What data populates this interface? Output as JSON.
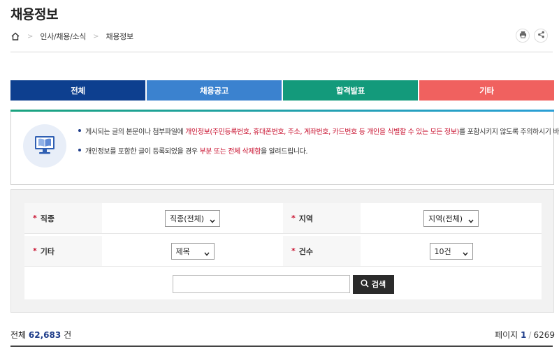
{
  "page_title": "채용정보",
  "breadcrumb": {
    "items": [
      "인사/채용/소식",
      "채용정보"
    ]
  },
  "utils": {
    "print_icon": "printer-icon",
    "share_icon": "share-icon"
  },
  "tabs": [
    {
      "label": "전체",
      "color": "#0d3f8f"
    },
    {
      "label": "채용공고",
      "color": "#3b82cf"
    },
    {
      "label": "합격발표",
      "color": "#139a7b"
    },
    {
      "label": "기타",
      "color": "#f0615f"
    }
  ],
  "notice": {
    "icon": "book-monitor-icon",
    "line1_pre": "게시되는 글의 본문이나 첨부파일에 ",
    "line1_red": "개인정보(주민등록번호, 휴대폰번호, 주소, 계좌번호, 카드번호 등 개인을 식별할 수 있는 모든 정보)",
    "line1_post": "를 포함시키지 않도록 주의하시기 바랍니다.",
    "line2_pre": "개인정보를 포함한 글이 등록되었을 경우 ",
    "line2_red": "부분 또는 전체 삭제함",
    "line2_post": "을 알려드립니다."
  },
  "search": {
    "required_mark": "*",
    "job_label": "직종",
    "job_value": "직종(전체)",
    "region_label": "지역",
    "region_value": "지역(전체)",
    "etc_label": "기타",
    "etc_value": "제목",
    "count_label": "건수",
    "count_value": "10건",
    "keyword_value": "",
    "button_label": "검색"
  },
  "summary": {
    "total_label": "전체",
    "total_count": "62,683",
    "total_unit": "건",
    "page_label": "페이지",
    "current_page": "1",
    "slash": "/",
    "total_pages": "6269"
  }
}
